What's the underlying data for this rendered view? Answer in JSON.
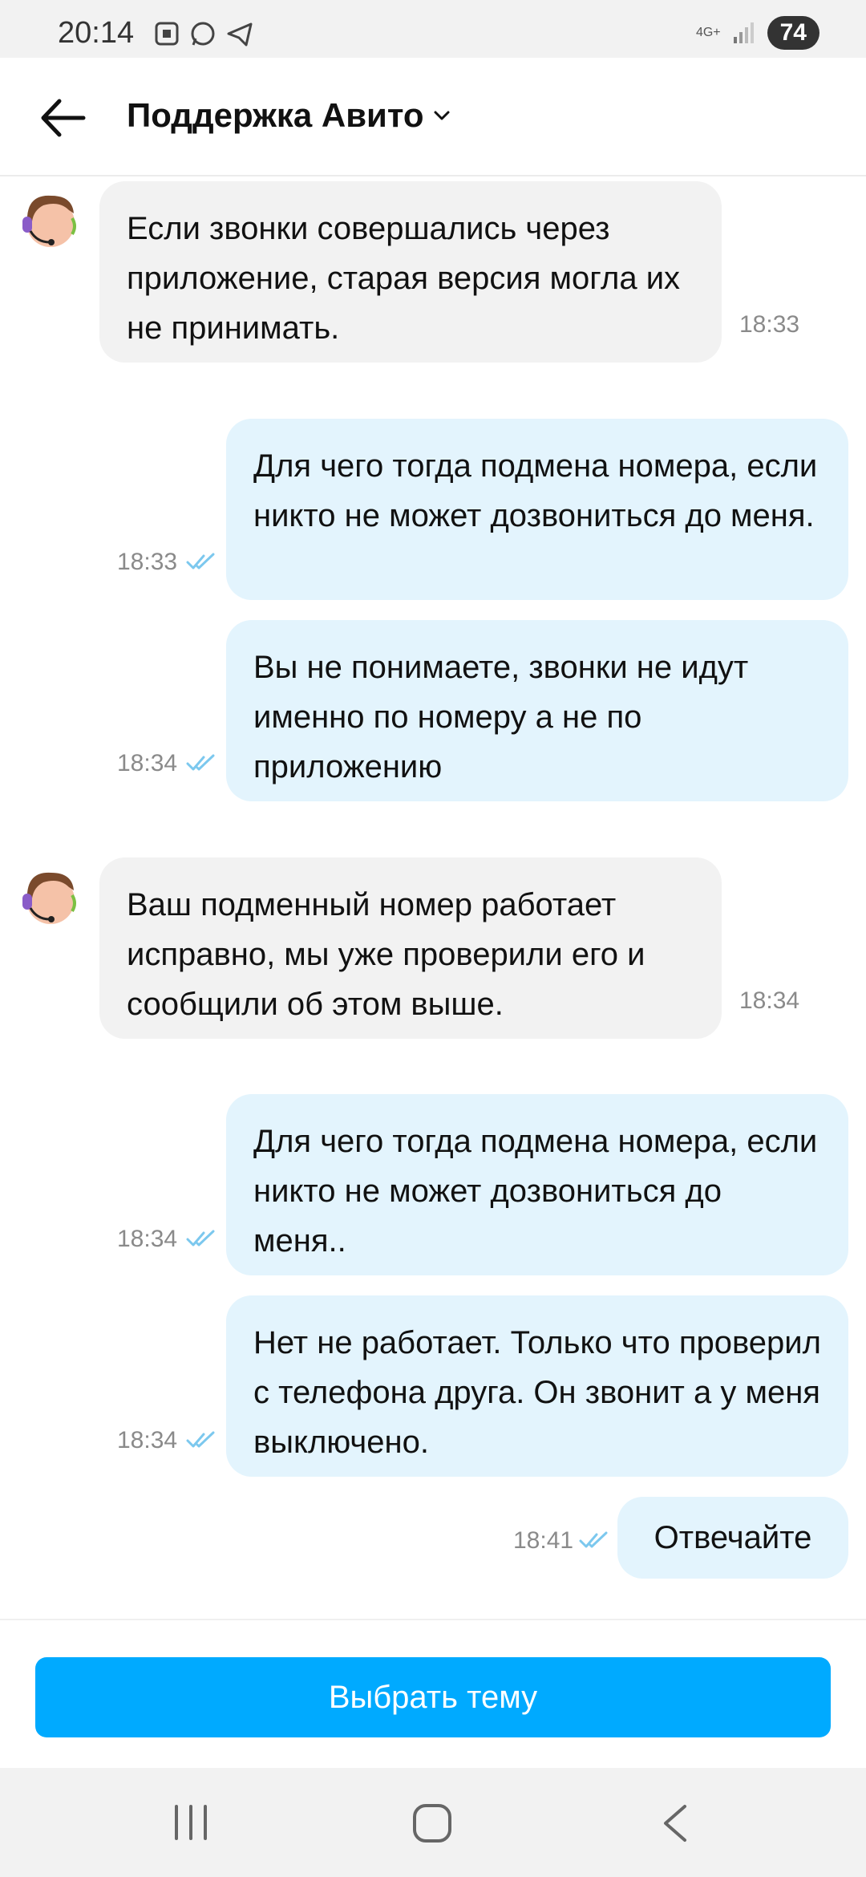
{
  "status_bar": {
    "time": "20:14",
    "network": "4G+",
    "battery": "74"
  },
  "header": {
    "title": "Поддержка Авито"
  },
  "messages": [
    {
      "direction": "in",
      "text": "Если звонки совершались через приложение, старая версия могла их не принимать.",
      "time": "18:33"
    },
    {
      "direction": "out",
      "text": "Для чего тогда подмена номера, если никто не может дозвониться до меня.",
      "time": "18:33",
      "status": "read"
    },
    {
      "direction": "out",
      "text": "Вы не понимаете,  звонки не идут именно по номеру а не по приложению",
      "time": "18:34",
      "status": "read"
    },
    {
      "direction": "in",
      "text": "Ваш подменный номер работает исправно, мы уже проверили его и сообщили об этом выше.",
      "time": "18:34"
    },
    {
      "direction": "out",
      "text": "Для чего тогда подмена номера, если никто не может дозвониться до меня..",
      "time": "18:34",
      "status": "read"
    },
    {
      "direction": "out",
      "text": "Нет не работает.  Только что проверил с телефона друга. Он звонит а у меня выключено.",
      "time": "18:34",
      "status": "read"
    },
    {
      "direction": "out",
      "text": "Отвечайте",
      "time": "18:41",
      "status": "read"
    }
  ],
  "bottom": {
    "choose_topic_label": "Выбрать тему"
  },
  "colors": {
    "accent": "#00aaff",
    "outgoing_bubble": "#e3f4fd",
    "incoming_bubble": "#f2f2f2",
    "read_checks": "#7cc8ee"
  }
}
